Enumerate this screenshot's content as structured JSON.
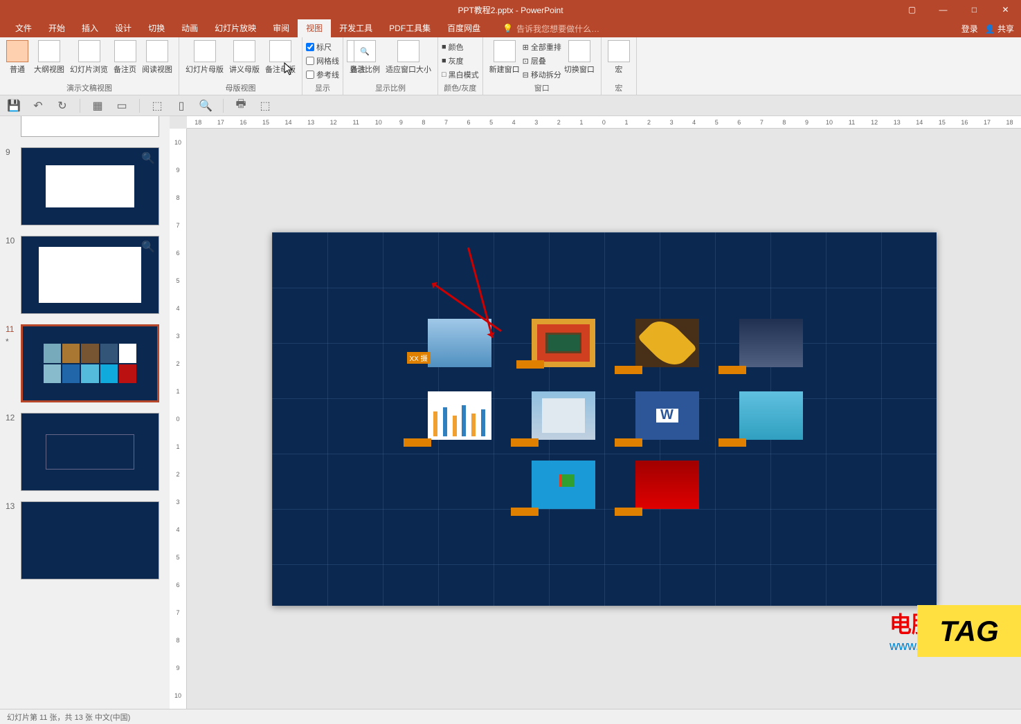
{
  "title": "PPT教程2.pptx - PowerPoint",
  "winctrls": {
    "min": "—",
    "max": "□",
    "close": "✕",
    "restore": "▢"
  },
  "menu": {
    "file": "文件",
    "home": "开始",
    "insert": "插入",
    "design": "设计",
    "transition": "切换",
    "animation": "动画",
    "slideshow": "幻灯片放映",
    "review": "审阅",
    "view": "视图",
    "developer": "开发工具",
    "pdf": "PDF工具集",
    "baidu": "百度网盘"
  },
  "tellme": "告诉我您想要做什么…",
  "login": "登录",
  "share": "共享",
  "ribbon": {
    "g1": {
      "label": "演示文稿视图",
      "normal": "普通",
      "outline": "大纲视图",
      "sorter": "幻灯片浏览",
      "notes": "备注页",
      "reading": "阅读视图"
    },
    "g2": {
      "label": "母版视图",
      "slide": "幻灯片母版",
      "handout": "讲义母版",
      "notes": "备注母版"
    },
    "g3": {
      "label": "显示",
      "ruler": "标尺",
      "grid": "网格线",
      "guides": "参考线",
      "notes": "备注"
    },
    "g4": {
      "label": "显示比例",
      "zoom": "显示比例",
      "fit": "适应窗口大小"
    },
    "g5": {
      "label": "颜色/灰度",
      "color": "颜色",
      "gray": "灰度",
      "bw": "黑白模式"
    },
    "g6": {
      "label": "窗口",
      "new": "新建窗口",
      "arrange": "全部重排",
      "cascade": "层叠",
      "split": "移动拆分",
      "switch": "切换窗口"
    },
    "g7": {
      "label": "宏",
      "macro": "宏"
    }
  },
  "thumbs": [
    {
      "n": "9"
    },
    {
      "n": "10"
    },
    {
      "n": "11",
      "active": true
    },
    {
      "n": "12"
    },
    {
      "n": "13"
    }
  ],
  "ruler_h": [
    "18",
    "17",
    "16",
    "15",
    "14",
    "13",
    "12",
    "11",
    "10",
    "9",
    "8",
    "7",
    "6",
    "5",
    "4",
    "3",
    "2",
    "1",
    "0",
    "1",
    "2",
    "3",
    "4",
    "5",
    "6",
    "7",
    "8",
    "9",
    "10",
    "11",
    "12",
    "13",
    "14",
    "15",
    "16",
    "17",
    "18"
  ],
  "ruler_v": [
    "10",
    "9",
    "8",
    "7",
    "6",
    "5",
    "4",
    "3",
    "2",
    "1",
    "0",
    "1",
    "2",
    "3",
    "4",
    "5",
    "6",
    "7",
    "8",
    "9",
    "10"
  ],
  "piclabel": "XX 摄",
  "watermark": {
    "cn": "电脑技术网",
    "en": "www.tagxp.com"
  },
  "tag": "TAG",
  "status": "幻灯片第 11 张，共 13 张   中文(中国)"
}
